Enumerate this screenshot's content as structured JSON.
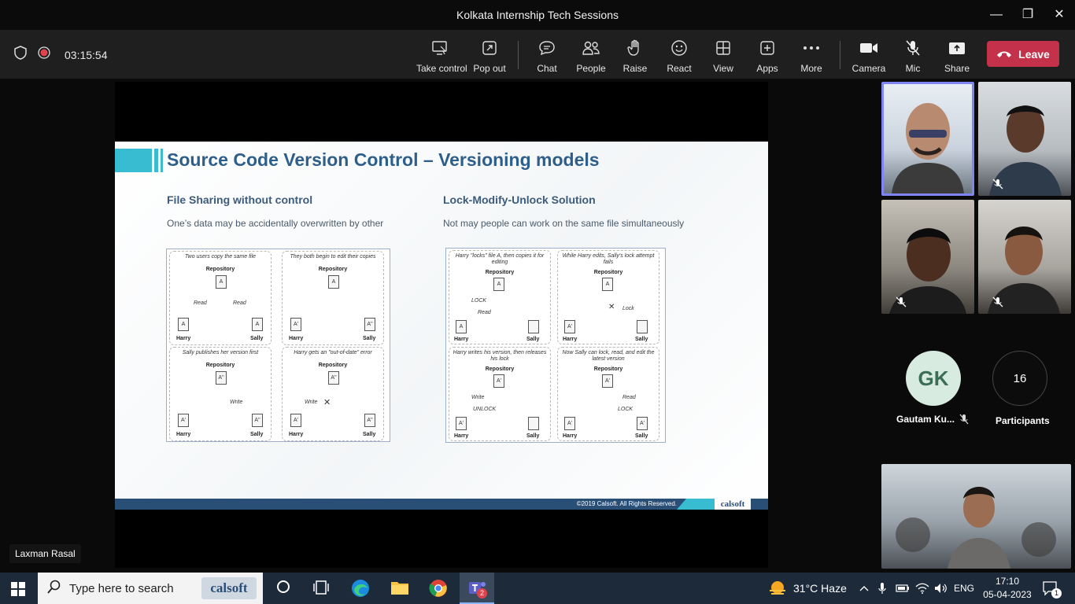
{
  "window": {
    "title": "Kolkata Internship Tech Sessions",
    "minimize": "—",
    "maximize": "❐",
    "close": "✕"
  },
  "toolbar": {
    "timer": "03:15:54",
    "buttons": [
      {
        "id": "take-control",
        "label": "Take control"
      },
      {
        "id": "pop-out",
        "label": "Pop out"
      },
      {
        "id": "chat",
        "label": "Chat"
      },
      {
        "id": "people",
        "label": "People"
      },
      {
        "id": "raise",
        "label": "Raise"
      },
      {
        "id": "react",
        "label": "React"
      },
      {
        "id": "view",
        "label": "View"
      },
      {
        "id": "apps",
        "label": "Apps"
      },
      {
        "id": "more",
        "label": "More"
      },
      {
        "id": "camera",
        "label": "Camera"
      },
      {
        "id": "mic",
        "label": "Mic"
      },
      {
        "id": "share",
        "label": "Share"
      }
    ],
    "leave_label": "Leave",
    "leave_color": "#c4314b"
  },
  "slide": {
    "title": "Source Code Version Control – Versioning models",
    "left_heading": "File Sharing without control",
    "left_sub": "One’s data may be accidentally overwritten by other",
    "right_heading": "Lock-Modify-Unlock Solution",
    "right_sub": "Not may people can work on the same file  simultaneously",
    "left_cells": [
      {
        "caption": "Two users copy the same file",
        "repo_label": "Repository",
        "repo_doc": "A",
        "left_doc": "A",
        "right_doc": "A",
        "left_arrow": "Read",
        "right_arrow": "Read",
        "left_user": "Harry",
        "right_user": "Sally"
      },
      {
        "caption": "They both begin to edit their copies",
        "repo_label": "Repository",
        "repo_doc": "A",
        "left_doc": "A'",
        "right_doc": "A''",
        "left_user": "Harry",
        "right_user": "Sally"
      },
      {
        "caption": "Sally publishes her version first",
        "repo_label": "Repository",
        "repo_doc": "A''",
        "left_doc": "A'",
        "right_doc": "A''",
        "right_arrow": "Write",
        "left_user": "Harry",
        "right_user": "Sally"
      },
      {
        "caption": "Harry gets an \"out-of-date\" error",
        "repo_label": "Repository",
        "repo_doc": "A''",
        "left_doc": "A'",
        "right_doc": "A''",
        "left_arrow": "Write",
        "left_user": "Harry",
        "right_user": "Sally"
      }
    ],
    "right_cells": [
      {
        "caption": "Harry \"locks\" file A, then copies it for editing",
        "repo_label": "Repository",
        "repo_doc": "A",
        "left_doc": "A",
        "right_doc": "",
        "left_arrow": "LOCK",
        "left_arrow2": "Read",
        "left_user": "Harry",
        "right_user": "Sally"
      },
      {
        "caption": "While Harry edits, Sally's lock attempt fails",
        "repo_label": "Repository",
        "repo_doc": "A",
        "left_doc": "A'",
        "right_doc": "",
        "right_arrow": "Lock",
        "left_user": "Harry",
        "right_user": "Sally"
      },
      {
        "caption": "Harry writes his version, then releases his lock",
        "repo_label": "Repository",
        "repo_doc": "A'",
        "left_doc": "A'",
        "right_doc": "",
        "left_arrow": "Write",
        "left_arrow2": "UNLOCK",
        "left_user": "Harry",
        "right_user": "Sally"
      },
      {
        "caption": "Now Sally can lock, read, and edit the latest version",
        "repo_label": "Repository",
        "repo_doc": "A'",
        "left_doc": "A'",
        "right_doc": "A'",
        "right_arrow": "Read",
        "right_arrow2": "LOCK",
        "left_user": "Harry",
        "right_user": "Sally"
      }
    ],
    "footer": "©2019 Calsoft.  All Rights Reserved.",
    "logo": "calsoft"
  },
  "presenter_name": "Laxman Rasal",
  "participants": {
    "gk_initials": "GK",
    "gk_name": "Gautam Ku...",
    "count": "16",
    "count_label": "Participants"
  },
  "taskbar": {
    "search_placeholder": "Type here to search",
    "search_logo": "calsoft",
    "teams_badge": "2",
    "weather": "31°C  Haze",
    "lang": "ENG",
    "time": "17:10",
    "date": "05-04-2023",
    "notif_count": "1"
  }
}
